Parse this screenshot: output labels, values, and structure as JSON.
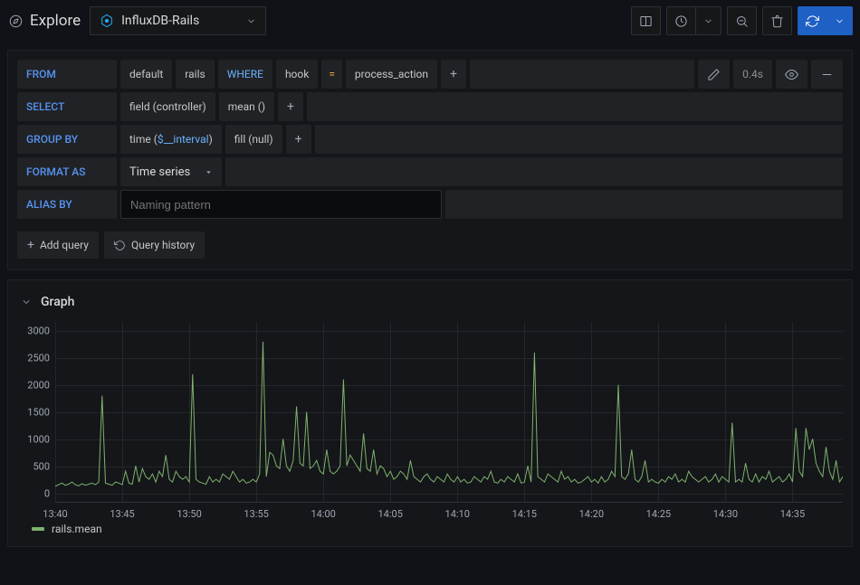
{
  "header": {
    "title": "Explore",
    "datasource": "InfluxDB-Rails"
  },
  "query": {
    "from_kw": "FROM",
    "from_policy": "default",
    "from_measurement": "rails",
    "where_kw": "WHERE",
    "where_field": "hook",
    "where_op": "=",
    "where_value": "process_action",
    "exec_time": "0.4s",
    "select_kw": "SELECT",
    "select_field": "field (controller)",
    "select_agg": "mean ()",
    "groupby_kw": "GROUP BY",
    "groupby_time_pre": "time (",
    "groupby_time_var": "$__interval",
    "groupby_time_post": ")",
    "groupby_fill": "fill (null)",
    "format_kw": "FORMAT AS",
    "format_value": "Time series",
    "alias_kw": "ALIAS BY",
    "alias_placeholder": "Naming pattern",
    "add_query_label": "Add query",
    "history_label": "Query history"
  },
  "chart_meta": {
    "panel_title": "Graph",
    "legend_label": "rails.mean"
  },
  "chart_data": {
    "type": "line",
    "title": "",
    "xlabel": "",
    "ylabel": "",
    "ylim": [
      0,
      3000
    ],
    "y_ticks": [
      0,
      500,
      1000,
      1500,
      2000,
      2500,
      3000
    ],
    "x_ticks": [
      "13:40",
      "13:45",
      "13:50",
      "13:55",
      "14:00",
      "14:05",
      "14:10",
      "14:15",
      "14:20",
      "14:25",
      "14:30",
      "14:35"
    ],
    "series": [
      {
        "name": "rails.mean",
        "color": "#7eb26d",
        "x": [
          "13:40:00",
          "13:40:15",
          "13:40:30",
          "13:40:45",
          "13:41:00",
          "13:41:15",
          "13:41:30",
          "13:41:45",
          "13:42:00",
          "13:42:15",
          "13:42:30",
          "13:42:45",
          "13:43:00",
          "13:43:15",
          "13:43:30",
          "13:43:45",
          "13:44:00",
          "13:44:15",
          "13:44:30",
          "13:44:45",
          "13:45:00",
          "13:45:15",
          "13:45:30",
          "13:45:45",
          "13:46:00",
          "13:46:15",
          "13:46:30",
          "13:46:45",
          "13:47:00",
          "13:47:15",
          "13:47:30",
          "13:47:45",
          "13:48:00",
          "13:48:15",
          "13:48:30",
          "13:48:45",
          "13:49:00",
          "13:49:15",
          "13:49:30",
          "13:49:45",
          "13:50:00",
          "13:50:15",
          "13:50:30",
          "13:50:45",
          "13:51:00",
          "13:51:15",
          "13:51:30",
          "13:51:45",
          "13:52:00",
          "13:52:15",
          "13:52:30",
          "13:52:45",
          "13:53:00",
          "13:53:15",
          "13:53:30",
          "13:53:45",
          "13:54:00",
          "13:54:15",
          "13:54:30",
          "13:54:45",
          "13:55:00",
          "13:55:15",
          "13:55:30",
          "13:55:45",
          "13:56:00",
          "13:56:15",
          "13:56:30",
          "13:56:45",
          "13:57:00",
          "13:57:15",
          "13:57:30",
          "13:57:45",
          "13:58:00",
          "13:58:15",
          "13:58:30",
          "13:58:45",
          "13:59:00",
          "13:59:15",
          "13:59:30",
          "13:59:45",
          "14:00:00",
          "14:00:15",
          "14:00:30",
          "14:00:45",
          "14:01:00",
          "14:01:15",
          "14:01:30",
          "14:01:45",
          "14:02:00",
          "14:02:15",
          "14:02:30",
          "14:02:45",
          "14:03:00",
          "14:03:15",
          "14:03:30",
          "14:03:45",
          "14:04:00",
          "14:04:15",
          "14:04:30",
          "14:04:45",
          "14:05:00",
          "14:05:15",
          "14:05:30",
          "14:05:45",
          "14:06:00",
          "14:06:15",
          "14:06:30",
          "14:06:45",
          "14:07:00",
          "14:07:15",
          "14:07:30",
          "14:07:45",
          "14:08:00",
          "14:08:15",
          "14:08:30",
          "14:08:45",
          "14:09:00",
          "14:09:15",
          "14:09:30",
          "14:09:45",
          "14:10:00",
          "14:10:15",
          "14:10:30",
          "14:10:45",
          "14:11:00",
          "14:11:15",
          "14:11:30",
          "14:11:45",
          "14:12:00",
          "14:12:15",
          "14:12:30",
          "14:12:45",
          "14:13:00",
          "14:13:15",
          "14:13:30",
          "14:13:45",
          "14:14:00",
          "14:14:15",
          "14:14:30",
          "14:14:45",
          "14:15:00",
          "14:15:15",
          "14:15:30",
          "14:15:45",
          "14:16:00",
          "14:16:15",
          "14:16:30",
          "14:16:45",
          "14:17:00",
          "14:17:15",
          "14:17:30",
          "14:17:45",
          "14:18:00",
          "14:18:15",
          "14:18:30",
          "14:18:45",
          "14:19:00",
          "14:19:15",
          "14:19:30",
          "14:19:45",
          "14:20:00",
          "14:20:15",
          "14:20:30",
          "14:20:45",
          "14:21:00",
          "14:21:15",
          "14:21:30",
          "14:21:45",
          "14:22:00",
          "14:22:15",
          "14:22:30",
          "14:22:45",
          "14:23:00",
          "14:23:15",
          "14:23:30",
          "14:23:45",
          "14:24:00",
          "14:24:15",
          "14:24:30",
          "14:24:45",
          "14:25:00",
          "14:25:15",
          "14:25:30",
          "14:25:45",
          "14:26:00",
          "14:26:15",
          "14:26:30",
          "14:26:45",
          "14:27:00",
          "14:27:15",
          "14:27:30",
          "14:27:45",
          "14:28:00",
          "14:28:15",
          "14:28:30",
          "14:28:45",
          "14:29:00",
          "14:29:15",
          "14:29:30",
          "14:29:45",
          "14:30:00",
          "14:30:15",
          "14:30:30",
          "14:30:45",
          "14:31:00",
          "14:31:15",
          "14:31:30",
          "14:31:45",
          "14:32:00",
          "14:32:15",
          "14:32:30",
          "14:32:45",
          "14:33:00",
          "14:33:15",
          "14:33:30",
          "14:33:45",
          "14:34:00",
          "14:34:15",
          "14:34:30",
          "14:34:45",
          "14:35:00",
          "14:35:15",
          "14:35:30",
          "14:35:45",
          "14:36:00",
          "14:36:15",
          "14:36:30",
          "14:36:45",
          "14:37:00",
          "14:37:15",
          "14:37:30",
          "14:37:45",
          "14:38:00",
          "14:38:15",
          "14:38:30",
          "14:38:45"
        ],
        "values": [
          120,
          150,
          180,
          140,
          160,
          200,
          150,
          130,
          170,
          140,
          160,
          180,
          150,
          200,
          1800,
          180,
          160,
          140,
          200,
          180,
          150,
          400,
          180,
          160,
          500,
          200,
          450,
          300,
          250,
          350,
          200,
          400,
          300,
          700,
          250,
          200,
          400,
          300,
          250,
          300,
          200,
          2200,
          250,
          200,
          180,
          160,
          300,
          200,
          250,
          200,
          350,
          300,
          250,
          400,
          300,
          200,
          250,
          180,
          200,
          250,
          200,
          350,
          2800,
          300,
          750,
          700,
          500,
          450,
          1000,
          500,
          400,
          600,
          1600,
          550,
          500,
          1500,
          450,
          500,
          600,
          400,
          350,
          800,
          400,
          350,
          400,
          500,
          2100,
          500,
          700,
          600,
          500,
          400,
          1100,
          450,
          400,
          800,
          350,
          500,
          450,
          300,
          400,
          250,
          300,
          400,
          350,
          250,
          600,
          300,
          250,
          200,
          300,
          350,
          250,
          200,
          300,
          250,
          200,
          350,
          250,
          200,
          300,
          200,
          250,
          180,
          200,
          300,
          250,
          200,
          300,
          250,
          400,
          200,
          180,
          250,
          200,
          300,
          250,
          200,
          350,
          180,
          200,
          500,
          200,
          2600,
          300,
          250,
          200,
          350,
          300,
          250,
          200,
          400,
          250,
          300,
          200,
          250,
          180,
          200,
          250,
          300,
          200,
          250,
          180,
          300,
          200,
          250,
          400,
          300,
          2000,
          300,
          250,
          350,
          800,
          250,
          200,
          300,
          600,
          200,
          250,
          200,
          180,
          250,
          200,
          300,
          250,
          350,
          200,
          250,
          200,
          400,
          300,
          250,
          200,
          250,
          300,
          200,
          250,
          350,
          200,
          300,
          250,
          200,
          1300,
          200,
          250,
          200,
          550,
          250,
          200,
          350,
          200,
          300,
          250,
          400,
          200,
          250,
          300,
          200,
          250,
          350,
          200,
          1200,
          400,
          300,
          1200,
          800,
          1000,
          550,
          400,
          300,
          850,
          400,
          250,
          600,
          200,
          300
        ]
      }
    ]
  }
}
